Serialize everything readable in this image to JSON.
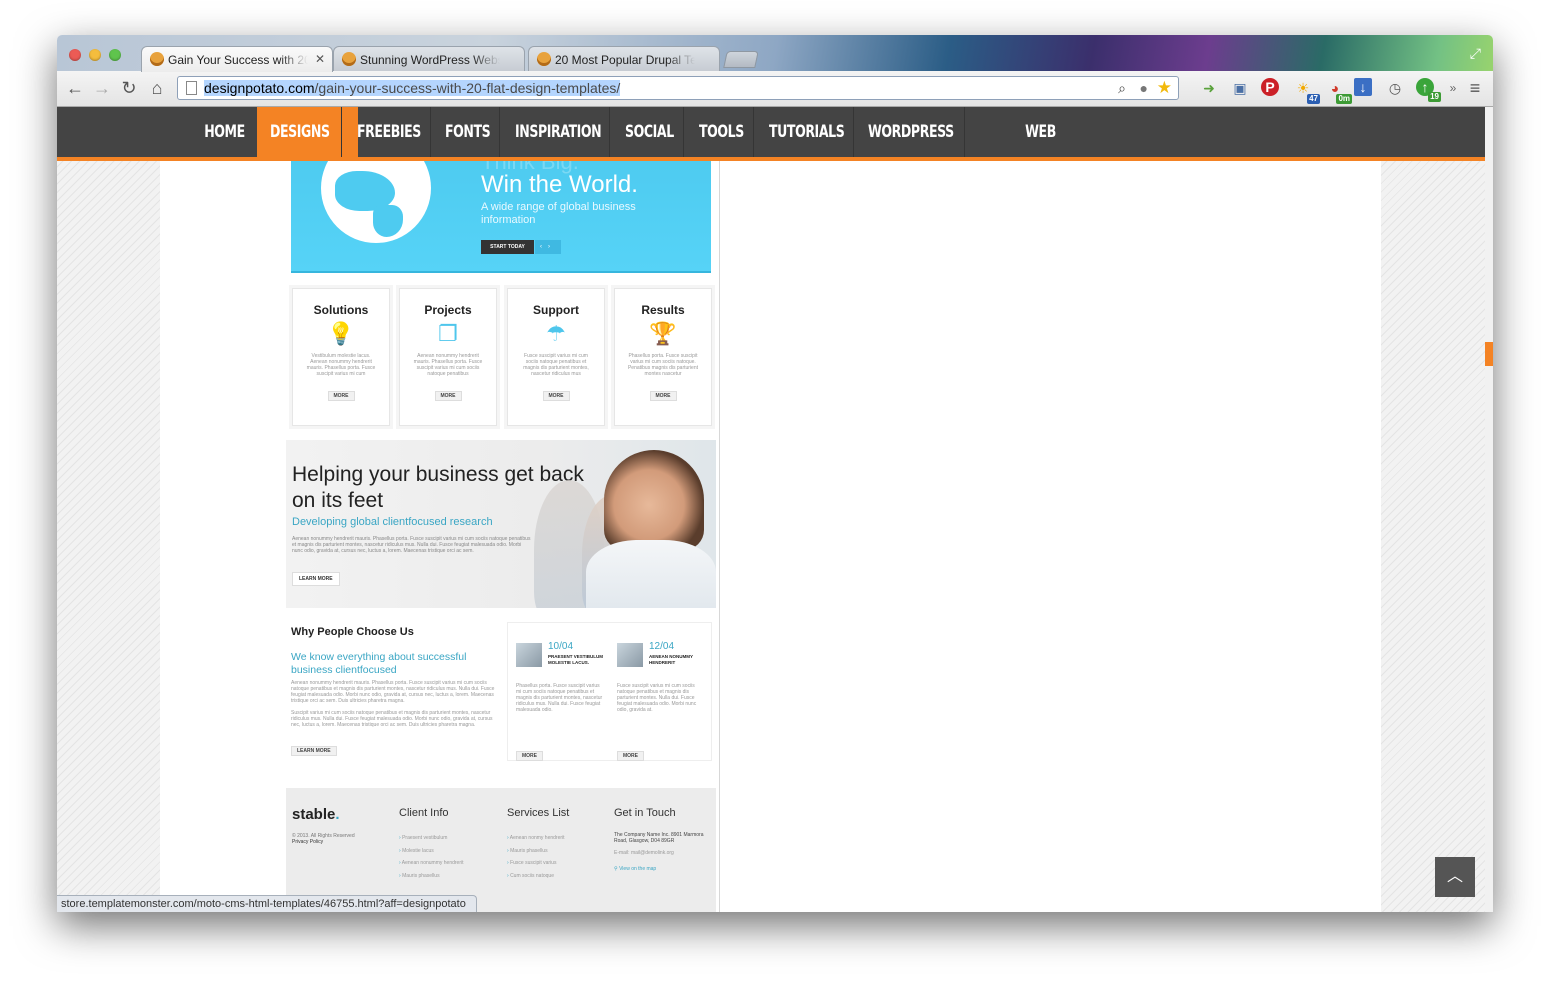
{
  "browser": {
    "tabs": [
      {
        "title": "Gain Your Success with 20",
        "active": true
      },
      {
        "title": "Stunning WordPress Websi",
        "active": false
      },
      {
        "title": "20 Most Popular Drupal Te",
        "active": false
      }
    ],
    "url_host": "designpotato.com",
    "url_path": "/gain-your-success-with-20-flat-design-templates/",
    "status_url": "store.templatemonster.com/moto-cms-html-templates/46755.html?aff=designpotato",
    "extensions": [
      {
        "name": "send-icon",
        "badge": ""
      },
      {
        "name": "window-icon",
        "badge": ""
      },
      {
        "name": "pinterest-icon",
        "badge": ""
      },
      {
        "name": "weather-icon",
        "badge": "47"
      },
      {
        "name": "timer-icon",
        "badge": "0m"
      },
      {
        "name": "download-icon",
        "badge": ""
      },
      {
        "name": "clock-icon",
        "badge": ""
      },
      {
        "name": "evernote-icon",
        "badge": "19"
      }
    ]
  },
  "site_nav": {
    "items": [
      "HOME",
      "DESIGNS",
      "FREEBIES",
      "FONTS",
      "INSPIRATION",
      "SOCIAL",
      "TOOLS",
      "TUTORIALS",
      "WORDPRESS",
      "WEB DEVELOPMENT"
    ],
    "active": "DESIGNS",
    "accent_color": "#f48324"
  },
  "template": {
    "hero": {
      "faded_title": "Think Big.",
      "title": "Win the World.",
      "subtitle": "A wide range of global business information",
      "button": "START TODAY"
    },
    "features": [
      {
        "title": "Solutions",
        "icon": "lightbulb-icon",
        "text": "Vestibulum molestie lacus. Aenean nonummy hendrerit mauris. Phasellus porta. Fusce suscipit varius mi cum",
        "button": "MORE"
      },
      {
        "title": "Projects",
        "icon": "documents-icon",
        "text": "Aenean nonummy hendrerit mauris. Phasellus porta. Fusce suscipit varius mi cum sociis natoque penatibus",
        "button": "MORE"
      },
      {
        "title": "Support",
        "icon": "umbrella-icon",
        "text": "Fusce suscipit varius mi cum sociis natoque penatibus et magnis dis parturient montes, nascetur ridiculus mus",
        "button": "MORE"
      },
      {
        "title": "Results",
        "icon": "trophy-icon",
        "text": "Phasellus porta. Fusce suscipit varius mi cum sociis natoque. Penatibus magnis dis parturient montes nascetur",
        "button": "MORE"
      }
    ],
    "promo": {
      "heading": "Helping your business get back on its feet",
      "subheading": "Developing global clientfocused research",
      "text": "Aenean nonummy hendrerit mauris. Phasellus porta. Fusce suscipit varius mi cum sociis natoque penatibus et magnis dis parturient montes, nascetur ridiculus mus. Nulla dui. Fusce feugiat malesuada odio. Morbi nunc odio, gravida at, cursus nec, luctus a, lorem. Maecenas tristique orci ac sem.",
      "button": "LEARN MORE"
    },
    "why": {
      "heading": "Why People Choose Us",
      "subheading": "We know everything about successful business clientfocused",
      "text1": "Aenean nonummy hendrerit mauris. Phasellus porta. Fusce suscipit varius mi cum sociis natoque penatibus et magnis dis parturient montes, nascetur ridiculus mus. Nulla dui. Fusce feugiat malesuada odio. Morbi nunc odio, gravida at, cursus nec, luctus a, lorem. Maecenas tristique orci ac sem. Duis ultricies pharetra magna.",
      "text2": "Suscipit varius mi cum sociis natoque penatibus et magnis dis parturient montes, nascetur ridiculus mus. Nulla dui. Fusce feugiat malesuada odio. Morbi nunc odio, gravida at, cursus nec, luctus a, lorem. Maecenas tristique orci ac sem. Duis ultricies pharetra magna.",
      "button": "LEARN MORE"
    },
    "news": [
      {
        "date": "10/04",
        "title": "PRAESENT VESTIBULUM MOLESTIE LACUS.",
        "text": "Phasellus porta. Fusce suscipit varius mi cum sociis natoque penatibus et magnis dis parturient montes, nascetur ridiculus mus. Nulla dui. Fusce feugiat malesuada odio.",
        "button": "MORE"
      },
      {
        "date": "12/04",
        "title": "AENEAN NONUMMY HENDRERIT",
        "text": "Fusce suscipit varius mi cum sociis natoque penatibus et magnis dis parturient montes. Nulla dui. Fusce feugiat malesuada odio. Morbi nunc odio, gravida at.",
        "button": "MORE"
      }
    ],
    "footer": {
      "logo": "stable",
      "copyright": "© 2013. All Rights Reserved",
      "privacy": "Privacy Policy",
      "client_info_title": "Client Info",
      "client_info": [
        "Praesent vestibulum",
        "Molestie lacus",
        "Aenean nonummy hendrerit",
        "Mauris phasellus"
      ],
      "services_title": "Services List",
      "services": [
        "Aenean nonmy hendrerit",
        "Mauris phasellus",
        "Fusce suscipit varius",
        "Cum sociis natoque"
      ],
      "contact_title": "Get in Touch",
      "address": "The Company Name Inc. 8901 Marmora Road, Glasgow, D04 89GR",
      "email": "E-mail: mail@demolink.org",
      "map_link": "View on the map"
    }
  }
}
